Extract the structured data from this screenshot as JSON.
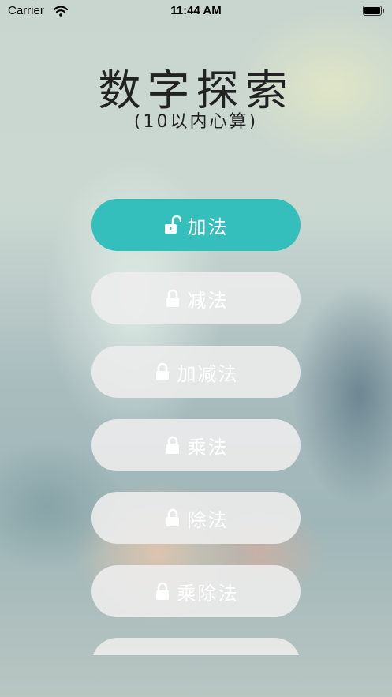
{
  "status_bar": {
    "carrier": "Carrier",
    "time": "11:44 AM"
  },
  "header": {
    "title": "数字探索",
    "subtitle": "(10以内心算)"
  },
  "colors": {
    "active_button": "#35bfbc",
    "locked_button": "#ececec",
    "button_text": "#ffffff"
  },
  "modes": [
    {
      "label": "加法",
      "icon": "unlock-icon",
      "locked": false
    },
    {
      "label": "减法",
      "icon": "lock-icon",
      "locked": true
    },
    {
      "label": "加减法",
      "icon": "lock-icon",
      "locked": true
    },
    {
      "label": "乘法",
      "icon": "lock-icon",
      "locked": true
    },
    {
      "label": "除法",
      "icon": "lock-icon",
      "locked": true
    },
    {
      "label": "乘除法",
      "icon": "lock-icon",
      "locked": true
    }
  ]
}
